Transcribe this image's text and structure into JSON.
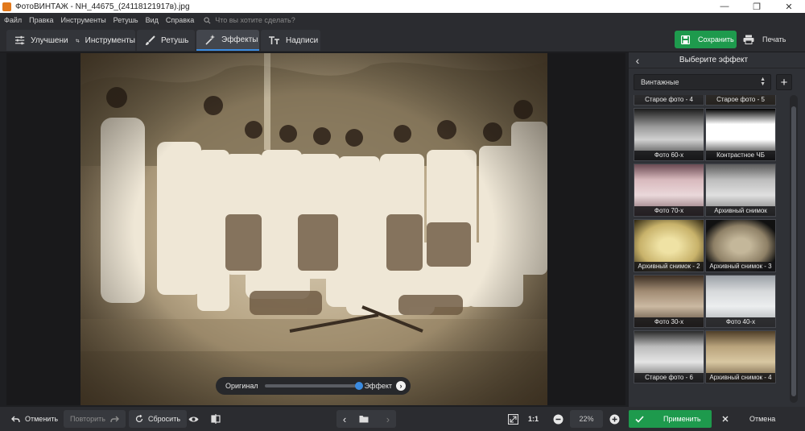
{
  "window": {
    "title": "ФотоВИНТАЖ - NH_44675_(24118121917в).jpg",
    "minimize": "—",
    "maximize": "❐",
    "close": "✕"
  },
  "menu": {
    "items": [
      "Файл",
      "Правка",
      "Инструменты",
      "Ретушь",
      "Вид",
      "Справка"
    ],
    "search_placeholder": "Что вы хотите сделать?"
  },
  "tabs": [
    {
      "label": "Улучшения",
      "icon": "sliders-icon"
    },
    {
      "label": "Инструменты",
      "icon": "crop-icon"
    },
    {
      "label": "Ретушь",
      "icon": "brush-icon"
    },
    {
      "label": "Эффекты",
      "icon": "magic-wand-icon"
    },
    {
      "label": "Надписи",
      "icon": "text-icon"
    }
  ],
  "actions": {
    "save": "Сохранить",
    "print": "Печать"
  },
  "compare": {
    "original": "Оригинал",
    "effect": "Эффект"
  },
  "panel": {
    "title": "Выберите эффект",
    "category": "Винтажные",
    "effects": [
      {
        "label": "Старое фото - 4",
        "style": "bw"
      },
      {
        "label": "Старое фото - 5",
        "style": "sepia"
      },
      {
        "label": "Фото 60-х",
        "style": "dark"
      },
      {
        "label": "Контрастное ЧБ",
        "style": "contrast"
      },
      {
        "label": "Фото 70-х",
        "style": "pink"
      },
      {
        "label": "Архивный снимок",
        "style": "gray"
      },
      {
        "label": "Архивный снимок - 2",
        "style": "yellow"
      },
      {
        "label": "Архивный снимок - 3",
        "style": "vignette"
      },
      {
        "label": "Фото 30-х",
        "style": "brown"
      },
      {
        "label": "Фото 40-х",
        "style": "silver"
      },
      {
        "label": "Старое фото - 6",
        "style": "bw2"
      },
      {
        "label": "Архивный снимок - 4",
        "style": "sepia2"
      }
    ]
  },
  "bottom": {
    "undo": "Отменить",
    "redo": "Повторить",
    "reset": "Сбросить",
    "ratio": "1:1",
    "zoom": "22%",
    "apply": "Применить",
    "cancel": "Отмена"
  }
}
